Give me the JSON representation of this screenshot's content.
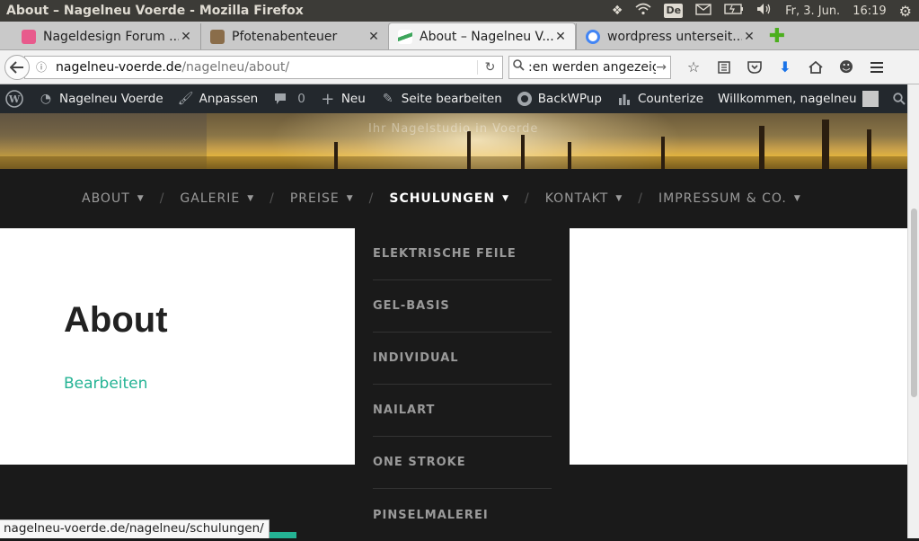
{
  "window": {
    "title": "About – Nagelneu Voerde - Mozilla Firefox"
  },
  "tray": {
    "keyboard": "De",
    "date": "Fr, 3. Jun.",
    "time": "16:19"
  },
  "tabs": [
    {
      "label": "Nageldesign Forum ...",
      "favicon_color": "#e85a8c"
    },
    {
      "label": "Pfotenabenteuer",
      "favicon_color": "#8a6d4a"
    },
    {
      "label": "About – Nagelneu V...",
      "favicon_color": "#3ea65c",
      "active": true
    },
    {
      "label": "wordpress unterseit...",
      "favicon_color": "#4285f4"
    }
  ],
  "urlbar": {
    "domain": "nagelneu-voerde.de",
    "path": "/nagelneu/about/"
  },
  "searchbar": {
    "value": ":en werden angezeigt"
  },
  "adminbar": {
    "site": "Nagelneu Voerde",
    "customize": "Anpassen",
    "comments": "0",
    "new": "Neu",
    "edit_page": "Seite bearbeiten",
    "backwpup": "BackWPup",
    "counterize": "Counterize",
    "greeting": "Willkommen, nagelneu"
  },
  "header": {
    "overlay_text": "Ihr Nagelstudio in Voerde"
  },
  "nav": {
    "about": "ABOUT",
    "galerie": "GALERIE",
    "preise": "PREISE",
    "schulungen": "SCHULUNGEN",
    "kontakt": "KONTAKT",
    "impressum": "IMPRESSUM & CO.",
    "separator": "/"
  },
  "dropdown": [
    "ELEKTRISCHE FEILE",
    "GEL-BASIS",
    "INDIVIDUAL",
    "NAILART",
    "ONE STROKE",
    "PINSELMALEREI"
  ],
  "content": {
    "title": "About",
    "edit_link": "Bearbeiten"
  },
  "statusbar": {
    "url": "nagelneu-voerde.de/nagelneu/schulungen/"
  },
  "colors": {
    "accent": "#24b394",
    "adminbar": "#23282d",
    "nav_bg": "#1a1a1a"
  }
}
